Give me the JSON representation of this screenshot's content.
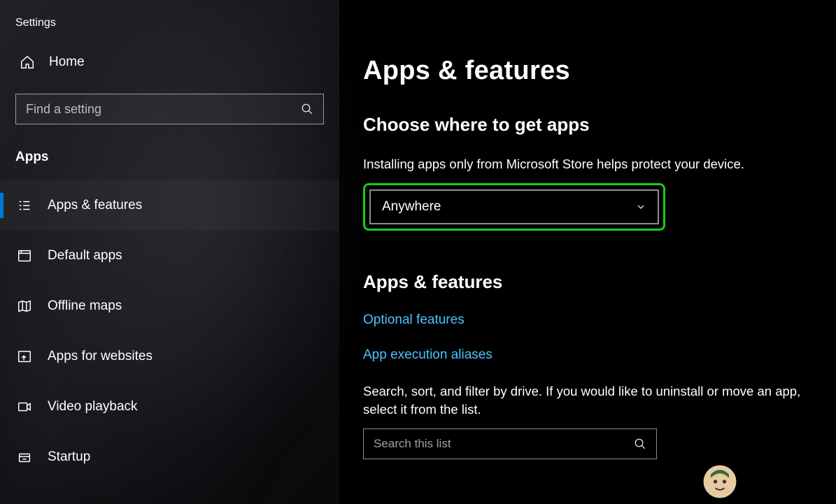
{
  "window": {
    "title": "Settings"
  },
  "sidebar": {
    "home_label": "Home",
    "search_placeholder": "Find a setting",
    "category_label": "Apps",
    "items": [
      {
        "label": "Apps & features",
        "icon": "list-icon",
        "active": true
      },
      {
        "label": "Default apps",
        "icon": "defaults-icon",
        "active": false
      },
      {
        "label": "Offline maps",
        "icon": "map-icon",
        "active": false
      },
      {
        "label": "Apps for websites",
        "icon": "website-app-icon",
        "active": false
      },
      {
        "label": "Video playback",
        "icon": "video-icon",
        "active": false
      },
      {
        "label": "Startup",
        "icon": "startup-icon",
        "active": false
      }
    ]
  },
  "main": {
    "page_title": "Apps & features",
    "section1": {
      "title": "Choose where to get apps",
      "description": "Installing apps only from Microsoft Store helps protect your device.",
      "select_value": "Anywhere"
    },
    "section2": {
      "title": "Apps & features",
      "link_optional": "Optional features",
      "link_aliases": "App execution aliases",
      "filter_text": "Search, sort, and filter by drive. If you would like to uninstall or move an app, select it from the list.",
      "search_placeholder": "Search this list"
    }
  },
  "colors": {
    "highlight": "#1ec81e",
    "accent": "#0078d4",
    "link": "#4cc2ff"
  }
}
